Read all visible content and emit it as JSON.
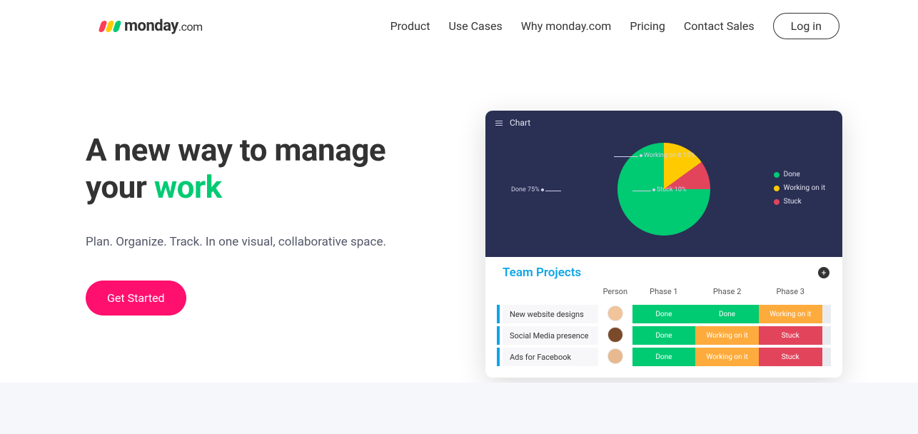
{
  "brand": {
    "name": "monday",
    "suffix": ".com"
  },
  "nav": {
    "items": [
      "Product",
      "Use Cases",
      "Why monday.com",
      "Pricing",
      "Contact Sales"
    ],
    "login": "Log in"
  },
  "hero": {
    "headline_a": "A new way to manage",
    "headline_b_pre": "your ",
    "headline_b_accent": "work",
    "subhead": "Plan. Organize. Track. In one visual, collaborative space.",
    "cta": "Get Started"
  },
  "preview": {
    "chart_title": "Chart",
    "callouts": {
      "working": "Working on it 15%",
      "stuck": "Stuck 10%",
      "done": "Done 75%"
    },
    "legend": [
      "Done",
      "Working on it",
      "Stuck"
    ],
    "table": {
      "title": "Team Projects",
      "columns": [
        "Person",
        "Phase 1",
        "Phase 2",
        "Phase 3"
      ],
      "rows": [
        {
          "task": "New website designs",
          "phases": [
            "Done",
            "Done",
            "Working on it"
          ]
        },
        {
          "task": "Social Media presence",
          "phases": [
            "Done",
            "Working on it",
            "Stuck"
          ]
        },
        {
          "task": "Ads for Facebook",
          "phases": [
            "Done",
            "Working on it",
            "Stuck"
          ]
        }
      ]
    }
  },
  "chart_data": {
    "type": "pie",
    "title": "Chart",
    "series": [
      {
        "name": "Done",
        "value": 75,
        "color": "#00ca72"
      },
      {
        "name": "Working on it",
        "value": 15,
        "color": "#ffcb00"
      },
      {
        "name": "Stuck",
        "value": 10,
        "color": "#e2445c"
      }
    ],
    "legend_position": "right"
  }
}
